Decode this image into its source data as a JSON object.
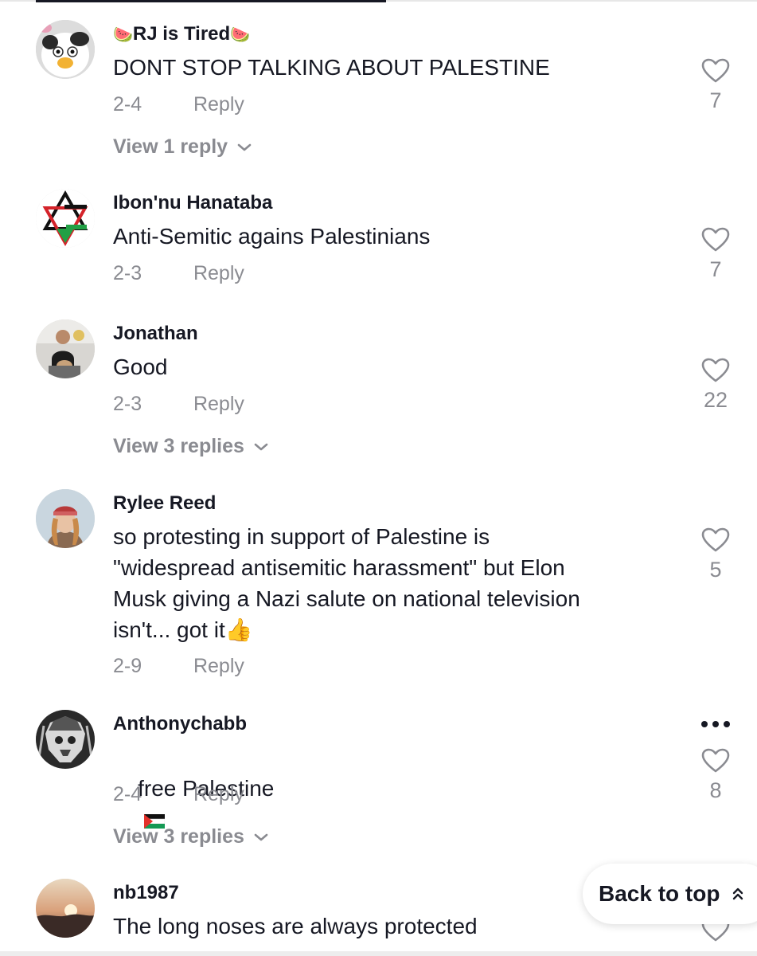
{
  "comments": [
    {
      "username_prefix": "🍉",
      "username": "RJ is Tired",
      "username_suffix": "🍉",
      "text": "DONT STOP TALKING ABOUT PALESTINE",
      "date": "2-4",
      "reply_label": "Reply",
      "likes": "7",
      "view_replies": "View 1 reply",
      "avatar_icon": "cow-plush-avatar"
    },
    {
      "username": "Ibon'nu Hanataba",
      "text": "Anti-Semitic agains Palestinians",
      "date": "2-3",
      "reply_label": "Reply",
      "likes": "7",
      "avatar_icon": "star-triangles-avatar"
    },
    {
      "username": "Jonathan",
      "text": "Good",
      "date": "2-3",
      "reply_label": "Reply",
      "likes": "22",
      "view_replies": "View 3 replies",
      "avatar_icon": "man-with-dog-avatar"
    },
    {
      "username": "Rylee Reed",
      "text": "so protesting in support of Palestine is\n\"widespread antisemitic harassment\" but Elon\nMusk giving a Nazi salute on national television\nisn't... got it👍",
      "date": "2-9",
      "reply_label": "Reply",
      "likes": "5",
      "avatar_icon": "person-cap-avatar"
    },
    {
      "username": "Anthonychabb",
      "text": "free Palestine",
      "text_flag": "palestine-flag-icon",
      "date": "2-4",
      "reply_label": "Reply",
      "likes": "8",
      "view_replies": "View 3 replies",
      "more_label": "•••",
      "avatar_icon": "headdress-skull-avatar"
    },
    {
      "username": "nb1987",
      "text": "The long noses are always protected",
      "avatar_icon": "sunset-landscape-avatar"
    }
  ],
  "back_to_top": "Back to top",
  "colors": {
    "text": "#161823",
    "muted": "#8a8b91",
    "background": "#ffffff"
  }
}
